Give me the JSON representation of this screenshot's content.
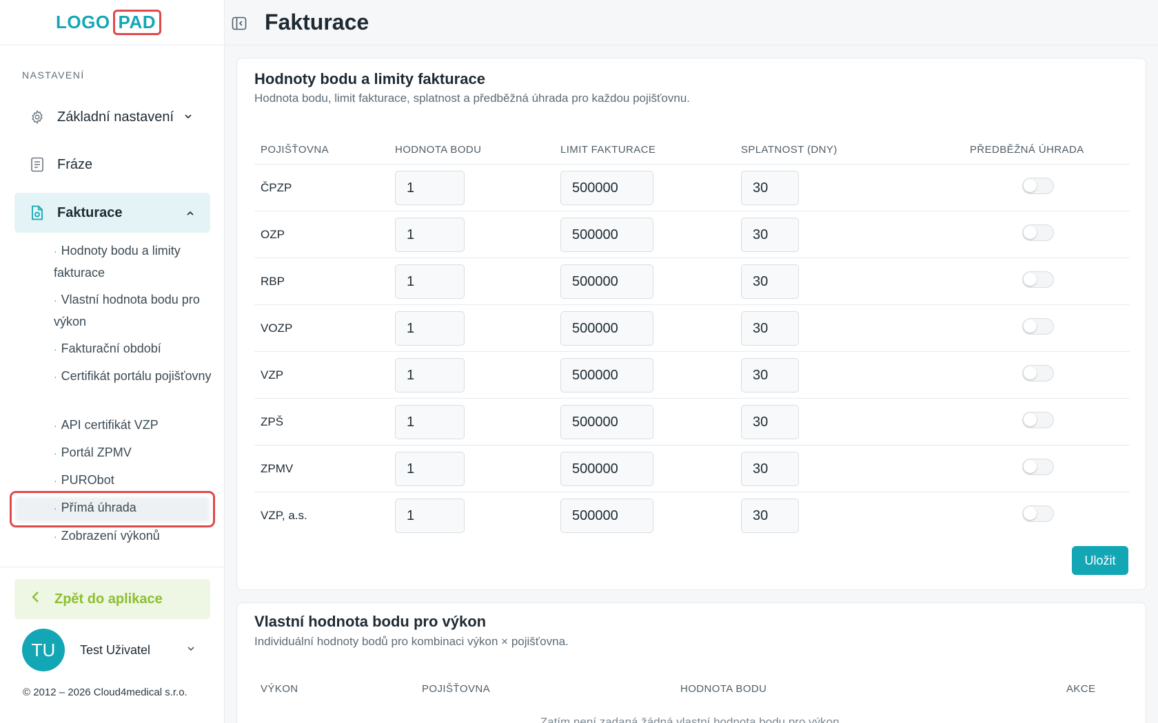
{
  "logo": {
    "part1": "LOGO",
    "part2": "PAD"
  },
  "sidebar": {
    "section_label": "NASTAVENÍ",
    "items": [
      {
        "label": "Základní nastavení",
        "icon": "gear-icon"
      },
      {
        "label": "Fráze",
        "icon": "document-icon"
      },
      {
        "label": "Fakturace",
        "icon": "invoice-icon"
      }
    ],
    "sub_items": [
      "Hodnoty bodu a limity fakturace",
      "Vlastní hodnota bodu pro výkon",
      "Fakturační období",
      "Certifikát portálu pojišťovny",
      "API certifikát VZP",
      "Portál ZPMV",
      "PURObot",
      "Přímá úhrada",
      "Zobrazení výkonů"
    ],
    "back_label": "Zpět do aplikace",
    "user": {
      "initials": "TU",
      "name": "Test Uživatel"
    },
    "copyright": "© 2012 – 2026 Cloud4medical s.r.o."
  },
  "header": {
    "title": "Fakturace"
  },
  "card1": {
    "title": "Hodnoty bodu a limity fakturace",
    "subtitle": "Hodnota bodu, limit fakturace, splatnost a předběžná úhrada pro každou pojišťovnu.",
    "columns": [
      "POJIŠŤOVNA",
      "HODNOTA BODU",
      "LIMIT FAKTURACE",
      "SPLATNOST (DNY)",
      "PŘEDBĚŽNÁ ÚHRADA"
    ],
    "rows": [
      {
        "name": "ČPZP",
        "bod": "1",
        "limit": "500000",
        "splatnost": "30",
        "uhrada": false
      },
      {
        "name": "OZP",
        "bod": "1",
        "limit": "500000",
        "splatnost": "30",
        "uhrada": false
      },
      {
        "name": "RBP",
        "bod": "1",
        "limit": "500000",
        "splatnost": "30",
        "uhrada": false
      },
      {
        "name": "VOZP",
        "bod": "1",
        "limit": "500000",
        "splatnost": "30",
        "uhrada": false
      },
      {
        "name": "VZP",
        "bod": "1",
        "limit": "500000",
        "splatnost": "30",
        "uhrada": false
      },
      {
        "name": "ZPŠ",
        "bod": "1",
        "limit": "500000",
        "splatnost": "30",
        "uhrada": false
      },
      {
        "name": "ZPMV",
        "bod": "1",
        "limit": "500000",
        "splatnost": "30",
        "uhrada": false
      },
      {
        "name": "VZP, a.s.",
        "bod": "1",
        "limit": "500000",
        "splatnost": "30",
        "uhrada": false
      }
    ],
    "save_label": "Uložit"
  },
  "card2": {
    "title": "Vlastní hodnota bodu pro výkon",
    "subtitle": "Individuální hodnoty bodů pro kombinaci výkon × pojišťovna.",
    "columns": [
      "VÝKON",
      "POJIŠŤOVNA",
      "HODNOTA BODU",
      "AKCE"
    ],
    "empty_message": "Zatím není zadaná žádná vlastní hodnota bodu pro výkon."
  },
  "colors": {
    "accent": "#13a6b5",
    "highlight_border": "#e0484a",
    "back_green": "#8bbf2f"
  }
}
